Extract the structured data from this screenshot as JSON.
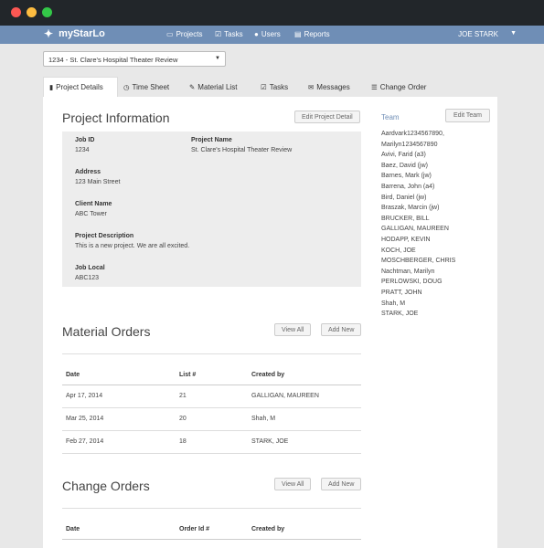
{
  "window": {
    "controls": [
      "close",
      "minimize",
      "zoom"
    ]
  },
  "nav": {
    "brand": "myStarLo",
    "brand_icon": "person-icon",
    "items": [
      {
        "label": "Projects",
        "icon": "folder-icon"
      },
      {
        "label": "Tasks",
        "icon": "checkbox-icon"
      },
      {
        "label": "Users",
        "icon": "user-icon"
      },
      {
        "label": "Reports",
        "icon": "document-icon"
      }
    ],
    "user": "JOE STARK"
  },
  "project_select": {
    "value": "1234 - St. Clare's Hospital Theater Review"
  },
  "tabs": [
    {
      "label": "Project Details",
      "icon": "file-icon"
    },
    {
      "label": "Time Sheet",
      "icon": "clock-icon"
    },
    {
      "label": "Material List",
      "icon": "book-icon"
    },
    {
      "label": "Tasks",
      "icon": "checkbox-icon"
    },
    {
      "label": "Messages",
      "icon": "envelope-icon"
    },
    {
      "label": "Change Order",
      "icon": "stack-icon"
    }
  ],
  "project_info": {
    "title": "Project Information",
    "edit_button": "Edit Project Detail",
    "job_id_label": "Job ID",
    "job_id": "1234",
    "project_name_label": "Project Name",
    "project_name": "St. Clare's Hospital Theater Review",
    "address_label": "Address",
    "address": "123 Main Street",
    "client_name_label": "Client Name",
    "client_name": "ABC Tower",
    "description_label": "Project Description",
    "description": "This is a new project. We are all excited.",
    "job_local_label": "Job Local",
    "job_local": "ABC123"
  },
  "team": {
    "title": "Team",
    "edit_button": "Edit Team",
    "members": [
      "Aardvark1234567890,",
      "Marilyn1234567890",
      "Avivi, Farid (a3)",
      "Baez, David (jw)",
      "Barnes, Mark (jw)",
      "Barrena, John (a4)",
      "Bird, Daniel (jw)",
      "Braszak, Marcin (jw)",
      "BRUCKER, BILL",
      "GALLIGAN, MAUREEN",
      "HODAPP, KEVIN",
      "KOCH, JOE",
      "MOSCHBERGER, CHRIS",
      "Nachtman, Marilyn",
      "PERLOWSKI, DOUG",
      "PRATT, JOHN",
      "Shah, M",
      "STARK, JOE"
    ]
  },
  "material_orders": {
    "title": "Material Orders",
    "view_all": "View All",
    "add_new": "Add New",
    "columns": [
      "Date",
      "List #",
      "Created by"
    ],
    "rows": [
      [
        "Apr 17, 2014",
        "21",
        "GALLIGAN, MAUREEN"
      ],
      [
        "Mar 25, 2014",
        "20",
        "Shah, M"
      ],
      [
        "Feb 27, 2014",
        "18",
        "STARK, JOE"
      ]
    ]
  },
  "change_orders": {
    "title": "Change Orders",
    "view_all": "View All",
    "add_new": "Add New",
    "columns": [
      "Date",
      "Order Id #",
      "Created by"
    ]
  },
  "colors": {
    "nav_bg": "#6f8eb6",
    "titlebar_bg": "#22262a",
    "accent": "#6f8eb6"
  }
}
